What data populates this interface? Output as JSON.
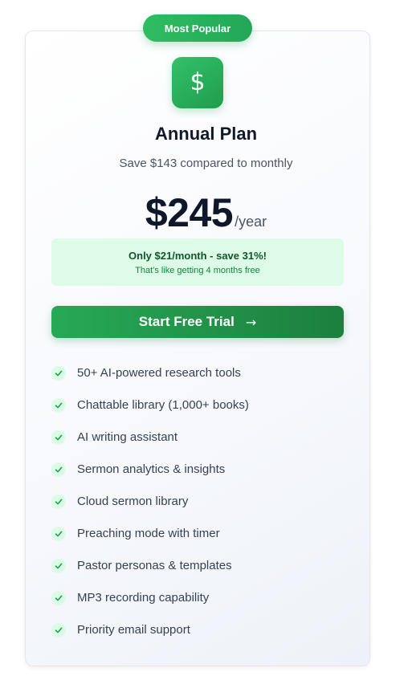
{
  "badge": {
    "label": "Most Popular"
  },
  "plan": {
    "icon": "dollar-sign-icon",
    "icon_glyph": "$",
    "title": "Annual Plan",
    "subtitle": "Save $143 compared to monthly"
  },
  "price": {
    "amount": "$245",
    "period": "/year"
  },
  "savings": {
    "main": "Only $21/month - save 31%!",
    "sub": "That's like getting 4 months free"
  },
  "cta": {
    "label": "Start Free Trial",
    "arrow": "→"
  },
  "features": [
    "50+ AI-powered research tools",
    "Chattable library (1,000+ books)",
    "AI writing assistant",
    "Sermon analytics & insights",
    "Cloud sermon library",
    "Preaching mode with timer",
    "Pastor personas & templates",
    "MP3 recording capability",
    "Priority email support"
  ],
  "colors": {
    "brand_green": "#22a756",
    "savings_bg": "#dcfce7",
    "text_dark": "#111827"
  }
}
